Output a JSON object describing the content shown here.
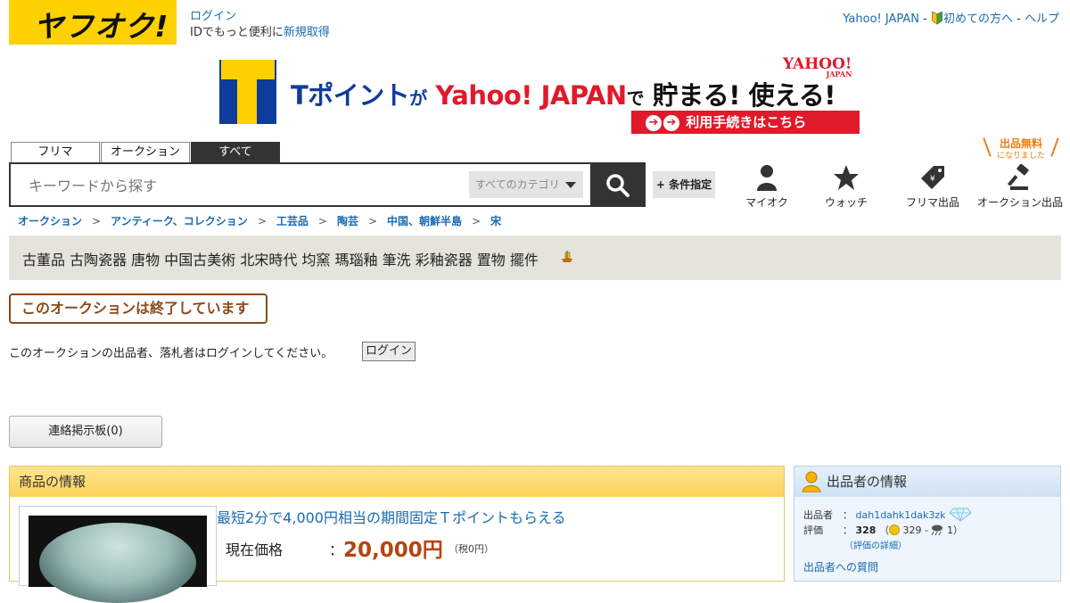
{
  "header": {
    "logo_text": "ヤフオク!",
    "login_label": "ログイン",
    "login_promo": "IDでもっと便利に",
    "signup_label": "新規取得",
    "top_links": {
      "yahoo_japan": "Yahoo! JAPAN",
      "beginners": "初めての方へ",
      "help": "ヘルプ",
      "sep": "-"
    }
  },
  "banner": {
    "tpoint": "Tポイント",
    "ga": "が",
    "yahoo": "Yahoo! JAPAN",
    "de": "で",
    "tamaru": "貯まる! 使える!",
    "yahoo_logo": "YAHOO!",
    "yahoo_logo_sub": "JAPAN",
    "button_label": "利用手続きはこちら"
  },
  "search": {
    "tabs": [
      {
        "label": "フリマ",
        "active": false
      },
      {
        "label": "オークション",
        "active": false
      },
      {
        "label": "すべて",
        "active": true
      }
    ],
    "placeholder": "キーワードから探す",
    "category_label": "すべてのカテゴリ",
    "condition_label": "+ 条件指定"
  },
  "nav_icons": [
    {
      "name": "my-auction",
      "label": "マイオク",
      "icon": "person-icon"
    },
    {
      "name": "watch",
      "label": "ウォッチ",
      "icon": "star-icon"
    },
    {
      "name": "flea-market-listing",
      "label": "フリマ出品",
      "icon": "price-tag-icon"
    },
    {
      "name": "auction-listing",
      "label": "オークション出品",
      "icon": "gavel-icon"
    }
  ],
  "free_badge": {
    "main": "出品無料",
    "sub": "になりました"
  },
  "breadcrumb": [
    "オークション",
    "アンティーク、コレクション",
    "工芸品",
    "陶芸",
    "中国、朝鮮半島",
    "宋"
  ],
  "breadcrumb_sep": ">",
  "item_title": "古董品 古陶瓷器 唐物 中国古美術 北宋時代 均窯 瑪瑙釉 筆洗 彩釉瓷器 置物 擺件",
  "status": {
    "ended_message": "このオークションは終了しています",
    "login_message": "このオークションの出品者、落札者はログインしてください。",
    "login_button": "ログイン",
    "board_button": "連絡掲示板(0)"
  },
  "item_info": {
    "header": "商品の情報",
    "promo_link": "最短2分で4,000円相当の期間固定Ｔポイントもらえる",
    "price_label": "現在価格",
    "price_colon": "：",
    "price": "20,000円",
    "tax": "（税0円）"
  },
  "seller_info": {
    "header": "出品者の情報",
    "seller_label": "出品者",
    "colon": "：",
    "seller_id": "dah1dahk1dak3zk",
    "rating_label": "評価",
    "rating_total": "328",
    "rating_open": "（",
    "rating_good": "329",
    "rating_dash": "-",
    "rating_bad": "1",
    "rating_close": "）",
    "rating_detail": "（評価の詳細）",
    "cut_text": "出品者への質問"
  },
  "colors": {
    "brand_yellow": "#ffd100",
    "link_blue": "#1a6bb0",
    "ended_brown": "#8a4a1c",
    "price_orange": "#b5440f",
    "free_orange": "#e87f14"
  }
}
